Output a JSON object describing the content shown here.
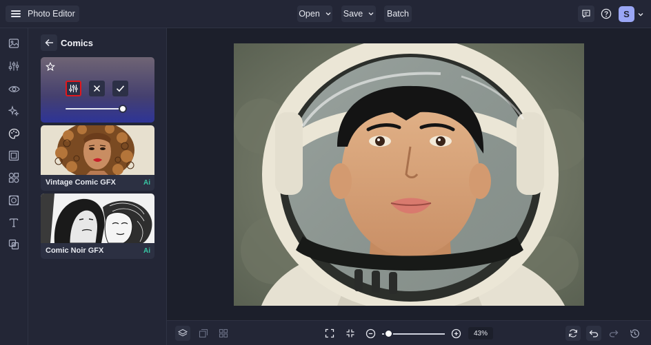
{
  "header": {
    "app_title": "Photo Editor",
    "open_label": "Open",
    "save_label": "Save",
    "batch_label": "Batch",
    "avatar_initial": "S"
  },
  "panel": {
    "title": "Comics",
    "active_effect_slider": 0.95,
    "effects": [
      {
        "label": "Vintage Comic GFX",
        "badge": "Ai"
      },
      {
        "label": "Comic Noir GFX",
        "badge": "Ai"
      }
    ]
  },
  "footer": {
    "zoom": "43%",
    "zoom_slider": 0.1
  },
  "colors": {
    "accent": "#9aa6f5",
    "ai_badge": "#38c7a4",
    "highlight": "#e3171c"
  }
}
